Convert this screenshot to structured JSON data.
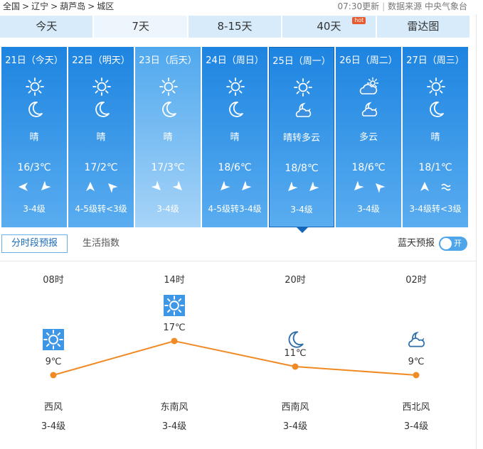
{
  "breadcrumb": [
    "全国",
    "辽宁",
    "葫芦岛",
    "城区"
  ],
  "update_time": "07:30更新",
  "source": "数据来源 中央气象台",
  "tabs": [
    "今天",
    "7天",
    "8-15天",
    "40天",
    "雷达图"
  ],
  "hot_badge": "hot",
  "days": [
    {
      "date": "21日（今天）",
      "icon_day": "sun-icon",
      "icon_night": "moon-icon",
      "weather": "晴",
      "temp": "16/3℃",
      "wind_dir": [
        "west",
        "southwest"
      ],
      "wind_level": "3-4级"
    },
    {
      "date": "22日（明天）",
      "icon_day": "sun-icon",
      "icon_night": "moon-icon",
      "weather": "晴",
      "temp": "17/2℃",
      "wind_dir": [
        "north",
        "northwest"
      ],
      "wind_level": "4-5级转<3级"
    },
    {
      "date": "23日（后天）",
      "icon_day": "sun-icon",
      "icon_night": "moon-icon",
      "weather": "晴",
      "temp": "17/3℃",
      "wind_dir": [
        "southeast",
        "southeast"
      ],
      "wind_level": "3-4级"
    },
    {
      "date": "24日（周日）",
      "icon_day": "sun-icon",
      "icon_night": "moon-icon",
      "weather": "晴",
      "temp": "18/6℃",
      "wind_dir": [
        "southwest",
        "southwest"
      ],
      "wind_level": "4-5级转3-4级"
    },
    {
      "date": "25日（周一）",
      "icon_day": "sun-icon",
      "icon_night": "moon-cloud-icon",
      "weather": "晴转多云",
      "temp": "18/8℃",
      "wind_dir": [
        "southwest",
        "southwest"
      ],
      "wind_level": "3-4级"
    },
    {
      "date": "26日（周二）",
      "icon_day": "sun-cloud-icon",
      "icon_night": "moon-cloud-icon",
      "weather": "多云",
      "temp": "18/6℃",
      "wind_dir": [
        "southwest",
        "northwest"
      ],
      "wind_level": "3-4级"
    },
    {
      "date": "27日（周三）",
      "icon_day": "sun-icon",
      "icon_night": "moon-icon",
      "weather": "晴",
      "temp": "18/1℃",
      "wind_dir": [
        "north",
        "variable"
      ],
      "wind_level": "3-4级转<3级"
    }
  ],
  "subtabs": [
    "分时段预报",
    "生活指数"
  ],
  "blue_sky": {
    "label": "蓝天预报",
    "toggle": "开"
  },
  "hourly": [
    {
      "time": "08时",
      "icon": "sun-icon",
      "temp": "9℃",
      "temp_value": 9,
      "wind": "西风",
      "level": "3-4级"
    },
    {
      "time": "14时",
      "icon": "sun-icon",
      "temp": "17℃",
      "temp_value": 17,
      "wind": "东南风",
      "level": "3-4级"
    },
    {
      "time": "20时",
      "icon": "moon-icon",
      "temp": "11℃",
      "temp_value": 11,
      "wind": "西南风",
      "level": "3-4级"
    },
    {
      "time": "02时",
      "icon": "moon-cloud-icon",
      "temp": "9℃",
      "temp_value": 9,
      "wind": "西北风",
      "level": "3-4级"
    }
  ],
  "colors": {
    "card": "#1d84e0",
    "card_light": "#7fc0f4",
    "line": "#f08a24",
    "accent": "#4ea5ea"
  }
}
